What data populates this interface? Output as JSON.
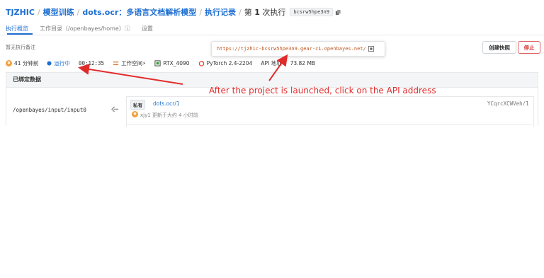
{
  "breadcrumb": {
    "user": "TJZHIC",
    "section": "模型训练",
    "project": "dots.ocr：多语言文档解析模型",
    "page": "执行记录",
    "current_prefix": "第",
    "current_number": "1",
    "current_suffix": "次执行",
    "hash": "bcsrw5hpe3n9"
  },
  "tabs": [
    {
      "label": "执行概览",
      "active": true
    },
    {
      "label": "工作目录（/openbayes/home）ⓘ",
      "active": false
    },
    {
      "label": "设置",
      "active": false
    }
  ],
  "note": "暂无执行备注",
  "buttons": {
    "snapshot": "创建快照",
    "stop": "停止"
  },
  "url_tooltip": "https://tjzhic-bcsrw5hpe3n9.gear-c1.openbayes.net/",
  "status": {
    "age": "41 分钟前",
    "state": "运行中",
    "duration": "00:12:35",
    "workspace": "工作空间⚡",
    "gpu": "RTX_4090",
    "framework": "PyTorch 2.4-2204",
    "api": "API 地址",
    "size": "73.82 MB"
  },
  "bound_data": {
    "title": "已绑定数据",
    "mount_path": "/openbayes/input/input0",
    "tag": "私有",
    "dataset_name": "dots.ocr/1",
    "dataset_hash": "YCqrcXCWVeh/1",
    "user_line": "xjy1 更新于大约 4 小时前"
  },
  "annotation": "After the project is launched, click on the API address",
  "colors": {
    "accent": "#1f6fd1",
    "running": "#1f6fd1",
    "danger": "#d73a3a",
    "annotation": "#e12b2b",
    "url": "#c0581f"
  }
}
